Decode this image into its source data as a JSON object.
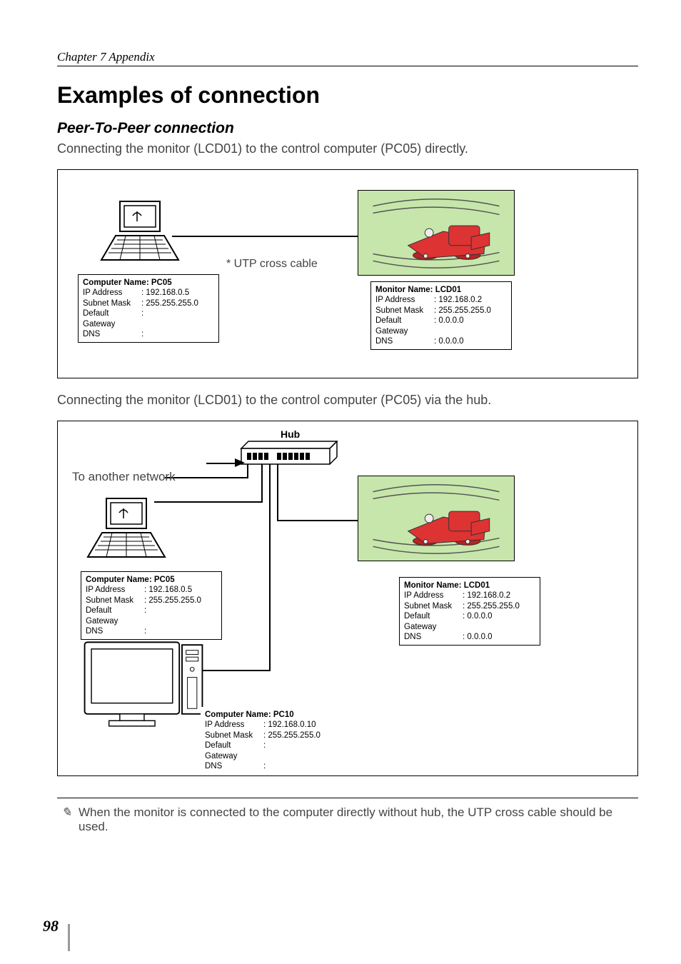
{
  "chapter": "Chapter 7 Appendix",
  "title": "Examples of connection",
  "subtitle": "Peer-To-Peer connection",
  "intro1": "Connecting the monitor (LCD01) to the control computer (PC05) directly.",
  "intro2": "Connecting the monitor (LCD01) to the control computer (PC05) via the hub.",
  "cable_label": "* UTP cross cable",
  "to_network": "To another network",
  "hub_label": "Hub",
  "pc05": {
    "title": "Computer Name: PC05",
    "ip_k": "IP Address",
    "ip_v": ": 192.168.0.5",
    "sm_k": "Subnet Mask",
    "sm_v": ": 255.255.255.0",
    "gw_k": "Default Gateway",
    "gw_v": ":",
    "dns_k": "DNS",
    "dns_v": ":"
  },
  "lcd01": {
    "title": "Monitor Name: LCD01",
    "ip_k": "IP Address",
    "ip_v": ": 192.168.0.2",
    "sm_k": "Subnet Mask",
    "sm_v": ": 255.255.255.0",
    "gw_k": "Default Gateway",
    "gw_v": ": 0.0.0.0",
    "dns_k": "DNS",
    "dns_v": ": 0.0.0.0"
  },
  "pc10": {
    "title": "Computer Name: PC10",
    "ip_k": "IP Address",
    "ip_v": ": 192.168.0.10",
    "sm_k": "Subnet Mask",
    "sm_v": ": 255.255.255.0",
    "gw_k": "Default Gateway",
    "gw_v": ":",
    "dns_k": "DNS",
    "dns_v": ":"
  },
  "footnote": "When the monitor is connected to the computer directly without hub, the UTP cross cable should be used.",
  "note_icon": "✎",
  "page_num": "98"
}
